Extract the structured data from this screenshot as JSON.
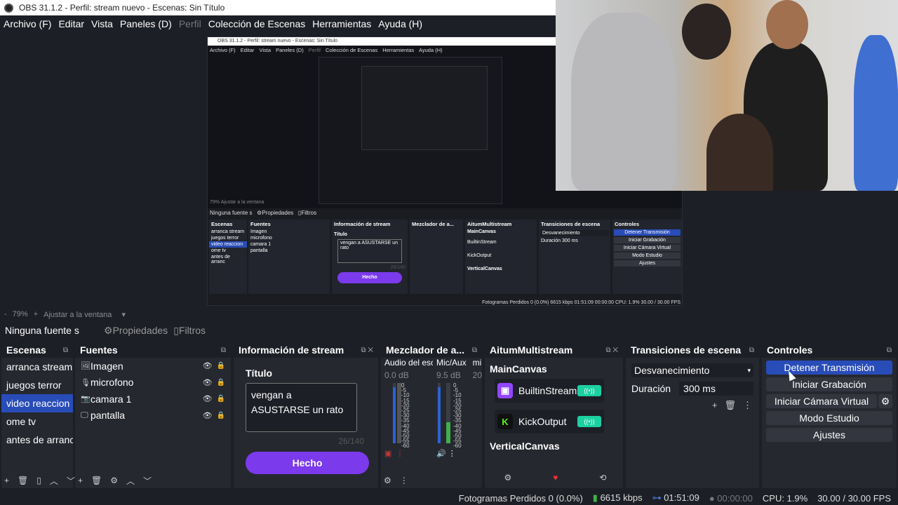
{
  "window_title": "OBS 31.1.2 - Perfil: stream nuevo - Escenas: Sin Título",
  "menu": [
    "Archivo (F)",
    "Editar",
    "Vista",
    "Paneles (D)",
    "Perfil",
    "Colección de Escenas",
    "Herramientas",
    "Ayuda (H)"
  ],
  "nested": {
    "title": "OBS 31.1.2 - Perfil: stream nuevo - Escenas: Sin Título",
    "menu": [
      "Archivo (F)",
      "Editar",
      "Vista",
      "Paneles (D)",
      "Perfil",
      "Colección de Escenas",
      "Herramientas",
      "Ayuda (H)"
    ],
    "zoom": "79%",
    "fit": "Ajustar a la ventana",
    "no_source": "Ninguna fuente s",
    "props": "Propiedades",
    "filters": "Filtros",
    "scenes_title": "Escenas",
    "scenes": [
      "arranca stream",
      "juegos terror",
      "video reaccion",
      "ome tv",
      "antes de arranc"
    ],
    "sources_title": "Fuentes",
    "sources": [
      "Imagen",
      "microfono",
      "camara 1",
      "pantalla"
    ],
    "info_title": "Información de stream",
    "titulo": "Título",
    "text": "vengan a ASUSTARSE un rato",
    "count": "26/140",
    "done": "Hecho",
    "mixer_title": "Mezclador de a...",
    "aitum_title": "AitumMultistream",
    "maincanvas": "MainCanvas",
    "builtin": "BuiltinStream",
    "kick": "KickOutput",
    "vertical": "VerticalCanvas",
    "trans_title": "Transiciones de escena",
    "trans_value": "Desvanecimiento",
    "dur_label": "Duración",
    "dur_value": "300 ms",
    "ctrl_title": "Controles",
    "ctrl": [
      "Detener Transmisión",
      "Iniciar Grabación",
      "Iniciar Cámara Virtual",
      "Modo Estudio",
      "Ajustes"
    ],
    "status": "Fotogramas Perdidos 0 (0.0%)   6615 kbps   01:51:09   00:00:00   CPU: 1.9%   30.00 / 30.00 FPS"
  },
  "zoom": {
    "minus": "-",
    "value": "79%",
    "plus": "+",
    "fit": "Ajustar a la ventana"
  },
  "source_bar": {
    "no_source": "Ninguna fuente s",
    "properties": "Propiedades",
    "filters": "Filtros"
  },
  "scenes": {
    "title": "Escenas",
    "items": [
      "arranca stream",
      "juegos terror",
      "video reaccion",
      "ome tv",
      "antes de arranc"
    ],
    "selected_index": 2
  },
  "sources": {
    "title": "Fuentes",
    "items": [
      {
        "name": "Imagen",
        "icon": "image-icon"
      },
      {
        "name": "microfono",
        "icon": "microphone-icon"
      },
      {
        "name": "camara 1",
        "icon": "camera-icon"
      },
      {
        "name": "pantalla",
        "icon": "monitor-icon"
      }
    ]
  },
  "info": {
    "title": "Información de stream",
    "label": "Título",
    "text": "vengan a ASUSTARSE un rato",
    "count": "26/140",
    "button": "Hecho"
  },
  "mixer": {
    "title": "Mezclador de a...",
    "channels": [
      {
        "name": "Audio del esc",
        "db": "0.0 dB"
      },
      {
        "name": "Mic/Aux",
        "db": "9.5 dB"
      },
      {
        "name": "mi",
        "db": "20"
      }
    ],
    "scale": [
      "0",
      "-5",
      "-10",
      "-15",
      "-20",
      "-25",
      "-30",
      "-35",
      "-40",
      "-45",
      "-50",
      "-55",
      "-60"
    ]
  },
  "aitum": {
    "title": "AitumMultistream",
    "canvas": "MainCanvas",
    "services": [
      {
        "name": "BuiltinStream",
        "color": "#9146ff",
        "logo": "twitch-icon"
      },
      {
        "name": "KickOutput",
        "color": "#53fc18",
        "logo": "kick-icon"
      }
    ],
    "vertical": "VerticalCanvas"
  },
  "transitions": {
    "title": "Transiciones de escena",
    "value": "Desvanecimiento",
    "duration_label": "Duración",
    "duration_value": "300 ms"
  },
  "controls": {
    "title": "Controles",
    "buttons": [
      "Detener Transmisión",
      "Iniciar Grabación",
      "Iniciar Cámara Virtual",
      "Modo Estudio",
      "Ajustes"
    ]
  },
  "status": {
    "dropped": "Fotogramas Perdidos 0 (0.0%)",
    "kbps": "6615 kbps",
    "stream_time": "01:51:09",
    "rec_time": "00:00:00",
    "cpu": "CPU: 1.9%",
    "fps": "30.00 / 30.00 FPS"
  },
  "colors": {
    "accent": "#284cb8",
    "purple": "#7c3aed",
    "teal": "#1bd1a1"
  }
}
